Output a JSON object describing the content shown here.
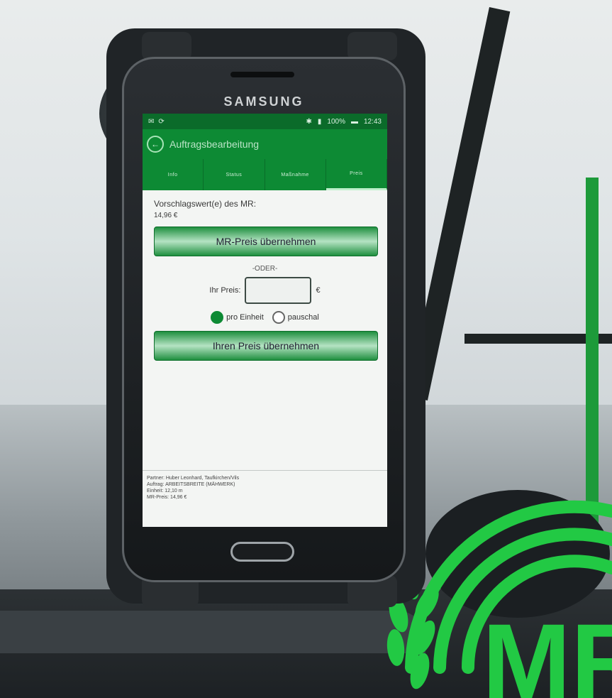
{
  "device": {
    "brand": "SAMSUNG"
  },
  "statusbar": {
    "time": "12:43",
    "battery": "100%"
  },
  "app": {
    "title": "Auftragsbearbeitung",
    "tabs": [
      "Info",
      "Status",
      "Maßnahme",
      "Preis"
    ],
    "active_tab_index": 3
  },
  "price": {
    "suggestion_label": "Vorschlagswert(e) des MR:",
    "suggestion_value": "14,96 €",
    "accept_mr_button": "MR-Preis übernehmen",
    "or_label": "-ODER-",
    "your_price_label": "Ihr Preis:",
    "your_price_value": "",
    "currency": "€",
    "radio_per_unit": "pro Einheit",
    "radio_flat": "pauschal",
    "radio_selected": "pro Einheit",
    "accept_own_button": "Ihren Preis übernehmen"
  },
  "footer": {
    "line1": "Partner: Huber Leonhard, Taufkirchen/Vils",
    "line2": "Auftrag: ARBEITSBREITE (MÄHWERK)",
    "line3": "Einheit: 12,10 m",
    "line4": "MR-Preis: 14,96 €"
  },
  "logo": {
    "text": "MR",
    "color": "#22c944"
  }
}
